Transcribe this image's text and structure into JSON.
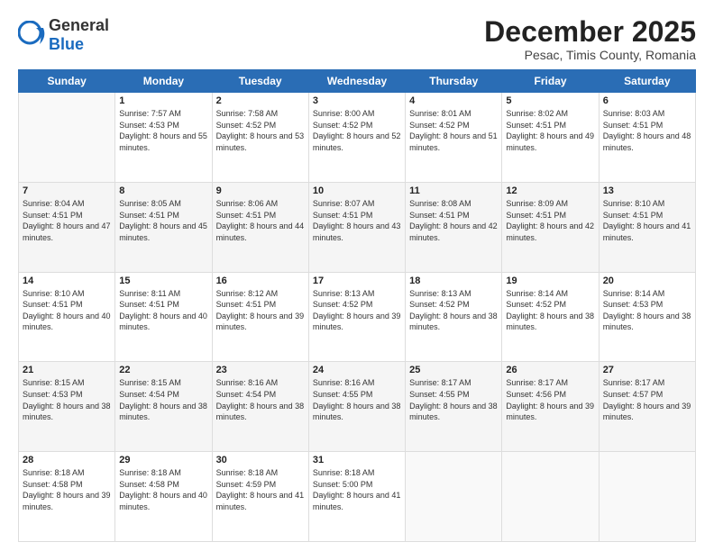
{
  "header": {
    "logo_general": "General",
    "logo_blue": "Blue",
    "month_title": "December 2025",
    "location": "Pesac, Timis County, Romania"
  },
  "weekdays": [
    "Sunday",
    "Monday",
    "Tuesday",
    "Wednesday",
    "Thursday",
    "Friday",
    "Saturday"
  ],
  "weeks": [
    [
      {
        "day": "",
        "sunrise": "",
        "sunset": "",
        "daylight": ""
      },
      {
        "day": "1",
        "sunrise": "Sunrise: 7:57 AM",
        "sunset": "Sunset: 4:53 PM",
        "daylight": "Daylight: 8 hours and 55 minutes."
      },
      {
        "day": "2",
        "sunrise": "Sunrise: 7:58 AM",
        "sunset": "Sunset: 4:52 PM",
        "daylight": "Daylight: 8 hours and 53 minutes."
      },
      {
        "day": "3",
        "sunrise": "Sunrise: 8:00 AM",
        "sunset": "Sunset: 4:52 PM",
        "daylight": "Daylight: 8 hours and 52 minutes."
      },
      {
        "day": "4",
        "sunrise": "Sunrise: 8:01 AM",
        "sunset": "Sunset: 4:52 PM",
        "daylight": "Daylight: 8 hours and 51 minutes."
      },
      {
        "day": "5",
        "sunrise": "Sunrise: 8:02 AM",
        "sunset": "Sunset: 4:51 PM",
        "daylight": "Daylight: 8 hours and 49 minutes."
      },
      {
        "day": "6",
        "sunrise": "Sunrise: 8:03 AM",
        "sunset": "Sunset: 4:51 PM",
        "daylight": "Daylight: 8 hours and 48 minutes."
      }
    ],
    [
      {
        "day": "7",
        "sunrise": "Sunrise: 8:04 AM",
        "sunset": "Sunset: 4:51 PM",
        "daylight": "Daylight: 8 hours and 47 minutes."
      },
      {
        "day": "8",
        "sunrise": "Sunrise: 8:05 AM",
        "sunset": "Sunset: 4:51 PM",
        "daylight": "Daylight: 8 hours and 45 minutes."
      },
      {
        "day": "9",
        "sunrise": "Sunrise: 8:06 AM",
        "sunset": "Sunset: 4:51 PM",
        "daylight": "Daylight: 8 hours and 44 minutes."
      },
      {
        "day": "10",
        "sunrise": "Sunrise: 8:07 AM",
        "sunset": "Sunset: 4:51 PM",
        "daylight": "Daylight: 8 hours and 43 minutes."
      },
      {
        "day": "11",
        "sunrise": "Sunrise: 8:08 AM",
        "sunset": "Sunset: 4:51 PM",
        "daylight": "Daylight: 8 hours and 42 minutes."
      },
      {
        "day": "12",
        "sunrise": "Sunrise: 8:09 AM",
        "sunset": "Sunset: 4:51 PM",
        "daylight": "Daylight: 8 hours and 42 minutes."
      },
      {
        "day": "13",
        "sunrise": "Sunrise: 8:10 AM",
        "sunset": "Sunset: 4:51 PM",
        "daylight": "Daylight: 8 hours and 41 minutes."
      }
    ],
    [
      {
        "day": "14",
        "sunrise": "Sunrise: 8:10 AM",
        "sunset": "Sunset: 4:51 PM",
        "daylight": "Daylight: 8 hours and 40 minutes."
      },
      {
        "day": "15",
        "sunrise": "Sunrise: 8:11 AM",
        "sunset": "Sunset: 4:51 PM",
        "daylight": "Daylight: 8 hours and 40 minutes."
      },
      {
        "day": "16",
        "sunrise": "Sunrise: 8:12 AM",
        "sunset": "Sunset: 4:51 PM",
        "daylight": "Daylight: 8 hours and 39 minutes."
      },
      {
        "day": "17",
        "sunrise": "Sunrise: 8:13 AM",
        "sunset": "Sunset: 4:52 PM",
        "daylight": "Daylight: 8 hours and 39 minutes."
      },
      {
        "day": "18",
        "sunrise": "Sunrise: 8:13 AM",
        "sunset": "Sunset: 4:52 PM",
        "daylight": "Daylight: 8 hours and 38 minutes."
      },
      {
        "day": "19",
        "sunrise": "Sunrise: 8:14 AM",
        "sunset": "Sunset: 4:52 PM",
        "daylight": "Daylight: 8 hours and 38 minutes."
      },
      {
        "day": "20",
        "sunrise": "Sunrise: 8:14 AM",
        "sunset": "Sunset: 4:53 PM",
        "daylight": "Daylight: 8 hours and 38 minutes."
      }
    ],
    [
      {
        "day": "21",
        "sunrise": "Sunrise: 8:15 AM",
        "sunset": "Sunset: 4:53 PM",
        "daylight": "Daylight: 8 hours and 38 minutes."
      },
      {
        "day": "22",
        "sunrise": "Sunrise: 8:15 AM",
        "sunset": "Sunset: 4:54 PM",
        "daylight": "Daylight: 8 hours and 38 minutes."
      },
      {
        "day": "23",
        "sunrise": "Sunrise: 8:16 AM",
        "sunset": "Sunset: 4:54 PM",
        "daylight": "Daylight: 8 hours and 38 minutes."
      },
      {
        "day": "24",
        "sunrise": "Sunrise: 8:16 AM",
        "sunset": "Sunset: 4:55 PM",
        "daylight": "Daylight: 8 hours and 38 minutes."
      },
      {
        "day": "25",
        "sunrise": "Sunrise: 8:17 AM",
        "sunset": "Sunset: 4:55 PM",
        "daylight": "Daylight: 8 hours and 38 minutes."
      },
      {
        "day": "26",
        "sunrise": "Sunrise: 8:17 AM",
        "sunset": "Sunset: 4:56 PM",
        "daylight": "Daylight: 8 hours and 39 minutes."
      },
      {
        "day": "27",
        "sunrise": "Sunrise: 8:17 AM",
        "sunset": "Sunset: 4:57 PM",
        "daylight": "Daylight: 8 hours and 39 minutes."
      }
    ],
    [
      {
        "day": "28",
        "sunrise": "Sunrise: 8:18 AM",
        "sunset": "Sunset: 4:58 PM",
        "daylight": "Daylight: 8 hours and 39 minutes."
      },
      {
        "day": "29",
        "sunrise": "Sunrise: 8:18 AM",
        "sunset": "Sunset: 4:58 PM",
        "daylight": "Daylight: 8 hours and 40 minutes."
      },
      {
        "day": "30",
        "sunrise": "Sunrise: 8:18 AM",
        "sunset": "Sunset: 4:59 PM",
        "daylight": "Daylight: 8 hours and 41 minutes."
      },
      {
        "day": "31",
        "sunrise": "Sunrise: 8:18 AM",
        "sunset": "Sunset: 5:00 PM",
        "daylight": "Daylight: 8 hours and 41 minutes."
      },
      {
        "day": "",
        "sunrise": "",
        "sunset": "",
        "daylight": ""
      },
      {
        "day": "",
        "sunrise": "",
        "sunset": "",
        "daylight": ""
      },
      {
        "day": "",
        "sunrise": "",
        "sunset": "",
        "daylight": ""
      }
    ]
  ]
}
